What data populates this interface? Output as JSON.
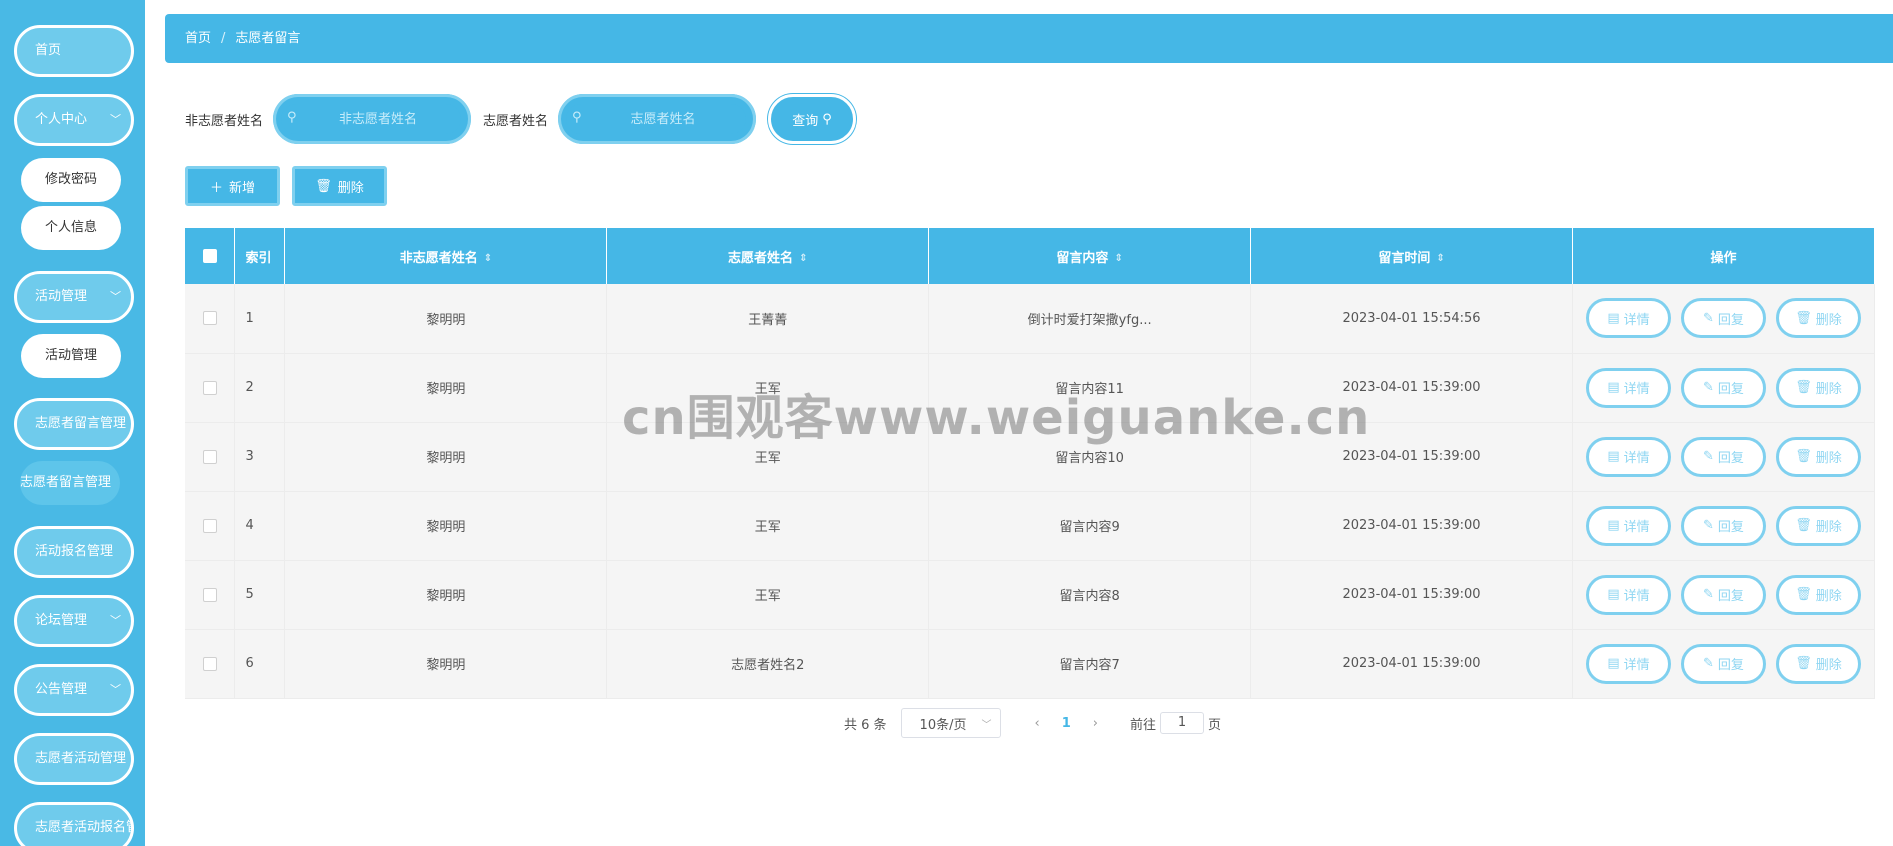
{
  "sidebar": {
    "items": [
      {
        "label": "首页"
      },
      {
        "label": "个人中心"
      },
      {
        "label": "活动管理"
      },
      {
        "label": "志愿者留言管理"
      },
      {
        "label": "活动报名管理"
      },
      {
        "label": "论坛管理"
      },
      {
        "label": "公告管理"
      },
      {
        "label": "志愿者活动管理"
      },
      {
        "label": "志愿者活动报名管"
      }
    ],
    "sub_items": {
      "personal": [
        "修改密码",
        "个人信息"
      ],
      "activity": [
        "活动管理"
      ],
      "message": [
        "志愿者留言管理"
      ]
    }
  },
  "breadcrumb": {
    "home": "首页",
    "sep": "/",
    "current": "志愿者留言"
  },
  "search": {
    "label1": "非志愿者姓名",
    "placeholder1": "非志愿者姓名",
    "label2": "志愿者姓名",
    "placeholder2": "志愿者姓名",
    "query_label": "查询"
  },
  "actions": {
    "add_label": "新增",
    "delete_label": "删除"
  },
  "table": {
    "headers": {
      "index": "索引",
      "non_volunteer": "非志愿者姓名",
      "volunteer": "志愿者姓名",
      "content": "留言内容",
      "time": "留言时间",
      "ops": "操作"
    },
    "rows": [
      {
        "index": "1",
        "non_volunteer": "黎明明",
        "volunteer": "王菁菁",
        "content": "倒计时爱打架撒yfg...",
        "time": "2023-04-01 15:54:56"
      },
      {
        "index": "2",
        "non_volunteer": "黎明明",
        "volunteer": "王军",
        "content": "留言内容11",
        "time": "2023-04-01 15:39:00"
      },
      {
        "index": "3",
        "non_volunteer": "黎明明",
        "volunteer": "王军",
        "content": "留言内容10",
        "time": "2023-04-01 15:39:00"
      },
      {
        "index": "4",
        "non_volunteer": "黎明明",
        "volunteer": "王军",
        "content": "留言内容9",
        "time": "2023-04-01 15:39:00"
      },
      {
        "index": "5",
        "non_volunteer": "黎明明",
        "volunteer": "王军",
        "content": "留言内容8",
        "time": "2023-04-01 15:39:00"
      },
      {
        "index": "6",
        "non_volunteer": "黎明明",
        "volunteer": "志愿者姓名2",
        "content": "留言内容7",
        "time": "2023-04-01 15:39:00"
      }
    ],
    "row_ops": {
      "detail": "详情",
      "reply": "回复",
      "delete": "删除"
    }
  },
  "pagination": {
    "total": "共 6 条",
    "page_size": "10条/页",
    "current_page": "1",
    "goto_prefix": "前往",
    "goto_value": "1",
    "goto_suffix": "页"
  },
  "watermark": "cn围观客www.weiguanke.cn",
  "colors": {
    "primary": "#45b7e6",
    "sidebar": "#49b9e5",
    "row_bg": "#f5f5f5"
  }
}
